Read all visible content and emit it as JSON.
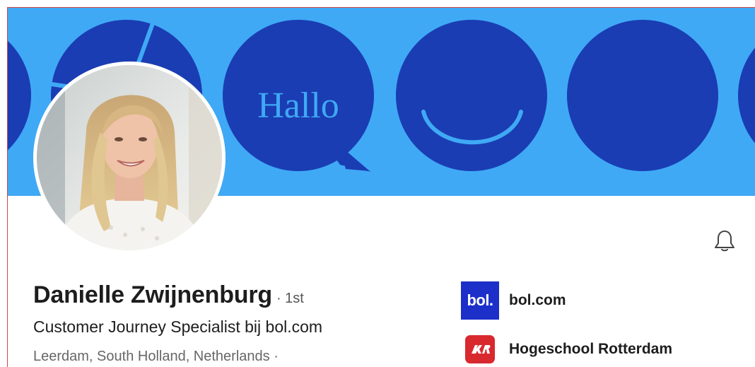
{
  "banner": {
    "greeting": "Hallo",
    "colors": {
      "background": "#3fa9f5",
      "bubble": "#1a3db3",
      "accent": "#3fa9f5"
    }
  },
  "profile": {
    "name": "Danielle Zwijnenburg",
    "connection_degree": "· 1st",
    "headline": "Customer Journey Specialist bij bol.com",
    "location": "Leerdam, South Holland, Netherlands ·"
  },
  "actions": {
    "notification_icon": "bell-icon"
  },
  "organizations": [
    {
      "logo_text": "bol.",
      "label": "bol.com",
      "logo_color": "#1c2fc9"
    },
    {
      "logo_icon": "hogeschool-rotterdam-logo",
      "label": "Hogeschool Rotterdam",
      "logo_color": "#d8292f"
    }
  ]
}
